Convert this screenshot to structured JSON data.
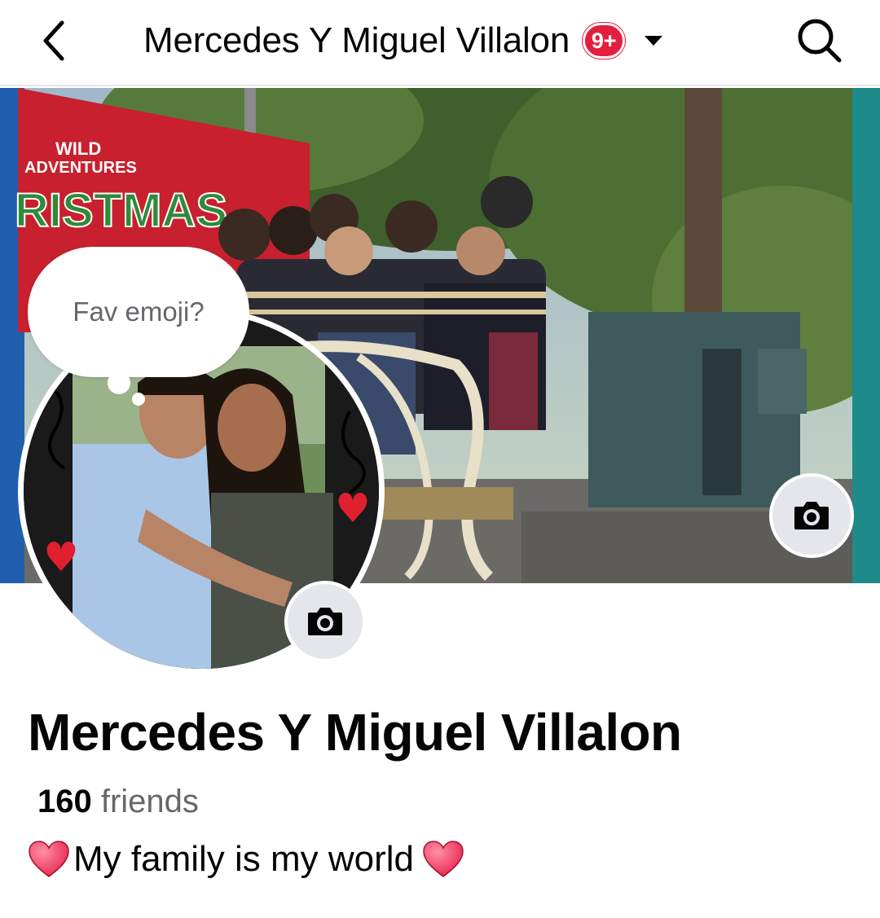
{
  "topbar": {
    "title": "Mercedes Y Miguel Villalon",
    "badge": "9+",
    "back_icon": "chevron-left-icon",
    "caret_icon": "caret-down-icon",
    "search_icon": "search-icon"
  },
  "cover": {
    "sign_line1": "WILD",
    "sign_line2": "ADVENTURES",
    "sign_line3": "RISTMAS",
    "camera_icon": "camera-icon"
  },
  "note": {
    "text": "Fav emoji?"
  },
  "profile": {
    "name": "Mercedes Y Miguel Villalon",
    "friends_count": "160",
    "friends_label": " friends",
    "bio_text": "My family is my world",
    "bio_emoji": "heart-emoji"
  },
  "colors": {
    "badge": "#e41e3f",
    "secondary_text": "#65676b",
    "camera_button_bg": "#e4e6eb"
  }
}
